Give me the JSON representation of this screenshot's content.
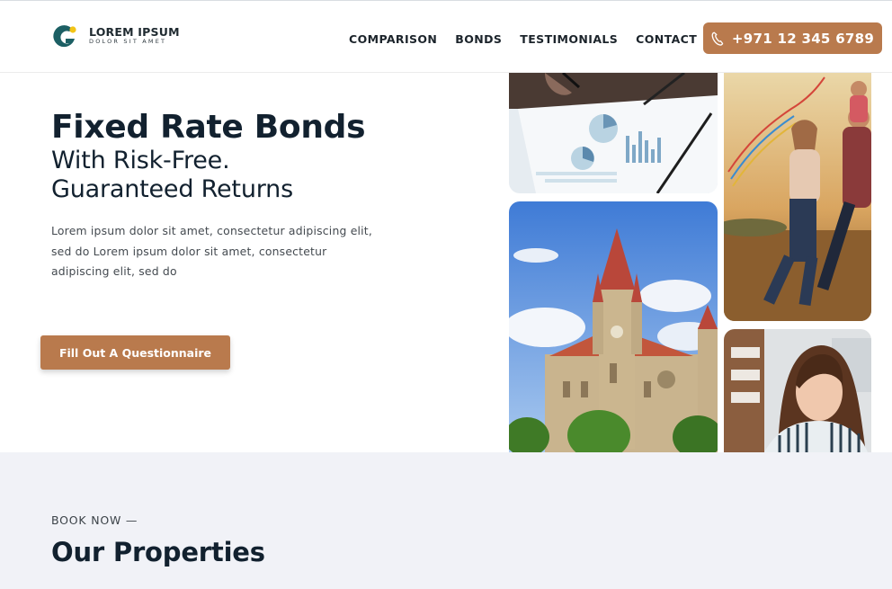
{
  "header": {
    "logo": {
      "name": "LOREM IPSUM",
      "tagline": "DOLOR SIT AMET"
    },
    "nav": [
      "COMPARISON",
      "BONDS",
      "TESTIMONIALS",
      "CONTACT"
    ],
    "phone": "+971 12 345 6789"
  },
  "hero": {
    "title": "Fixed Rate Bonds",
    "subtitle_line1": "With Risk-Free.",
    "subtitle_line2": "Guaranteed Returns",
    "body": "Lorem ipsum dolor sit amet, consectetur adipiscing elit, sed do Lorem ipsum dolor sit amet, consectetur adipiscing elit, sed do",
    "cta": "Fill Out A Questionnaire"
  },
  "properties": {
    "eyebrow": "BOOK NOW —",
    "title": "Our Properties"
  },
  "colors": {
    "accent": "#b97a4d",
    "heading": "#12212f",
    "section_bg": "#f1f2f7",
    "logo_teal": "#1c5f64",
    "logo_yellow": "#f2c417"
  },
  "icons": [
    "logo-mark-icon",
    "phone-icon"
  ]
}
